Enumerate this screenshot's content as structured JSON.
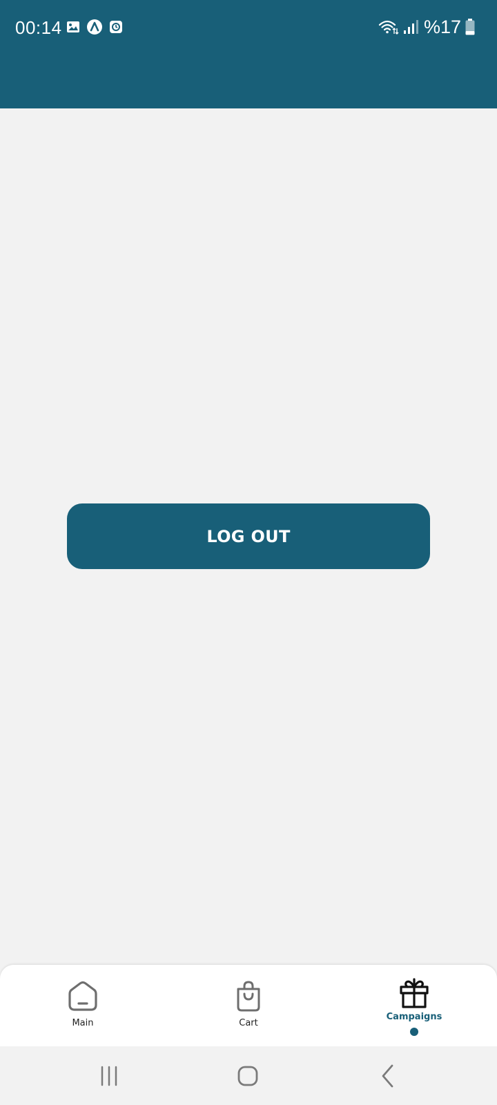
{
  "status_bar": {
    "time": "00:14",
    "battery_text": "%17",
    "icons": [
      "gallery-icon",
      "app-a-icon",
      "clock-app-icon",
      "wifi-icon",
      "signal-icon",
      "battery-icon"
    ]
  },
  "main": {
    "logout_label": "LOG OUT"
  },
  "bottom_nav": {
    "items": [
      {
        "label": "Main",
        "icon": "home-icon",
        "active": false
      },
      {
        "label": "Cart",
        "icon": "shopping-bag-icon",
        "active": false
      },
      {
        "label": "Campaigns",
        "icon": "gift-icon",
        "active": true
      }
    ]
  },
  "system_nav": {
    "icons": [
      "recents-icon",
      "home-button-icon",
      "back-icon"
    ]
  },
  "colors": {
    "primary": "#185f78",
    "background": "#f2f2f2",
    "nav_background": "#ffffff"
  }
}
